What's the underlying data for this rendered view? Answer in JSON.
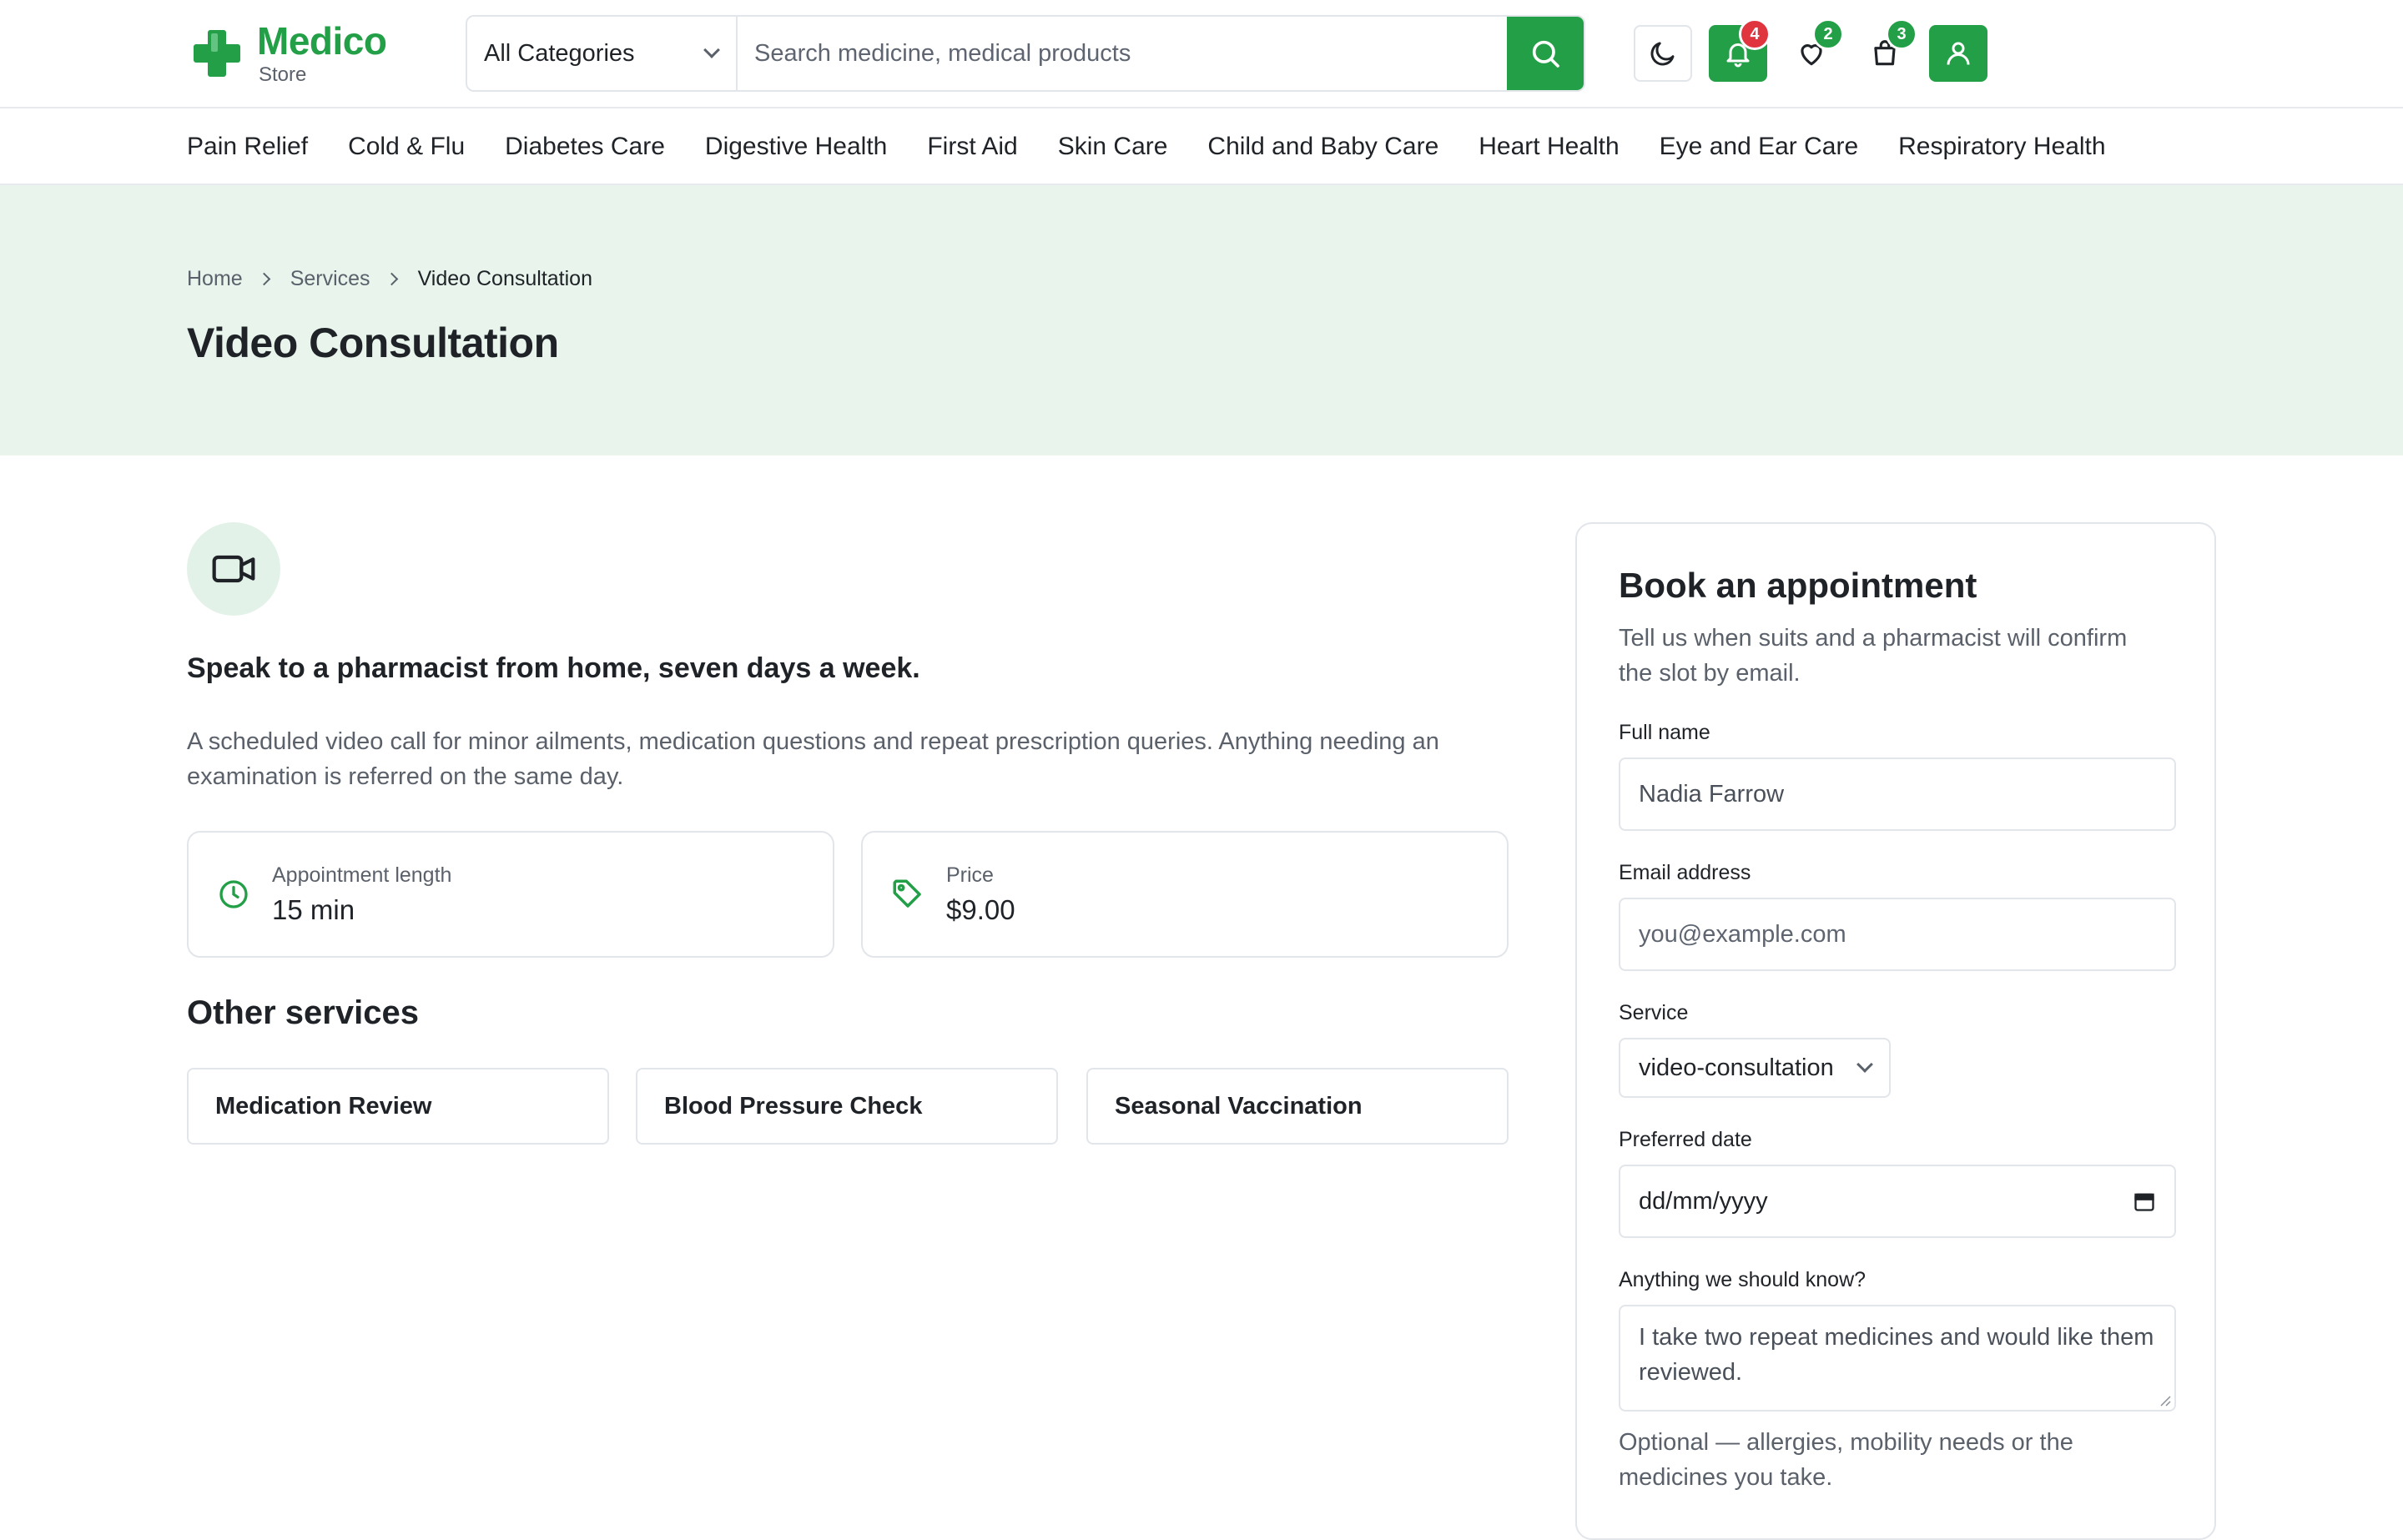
{
  "brand": {
    "name": "Medico",
    "sub": "Store",
    "color": "#23a047"
  },
  "search": {
    "category": "All Categories",
    "placeholder": "Search medicine, medical products"
  },
  "header_icons": {
    "theme": "moon-icon",
    "notifications": {
      "icon": "bell-icon",
      "count": "4"
    },
    "wishlist": {
      "icon": "heart-icon",
      "count": "2"
    },
    "cart": {
      "icon": "shopping-bag-icon",
      "count": "3"
    },
    "account": "user-icon"
  },
  "categories": [
    "Pain Relief",
    "Cold & Flu",
    "Diabetes Care",
    "Digestive Health",
    "First Aid",
    "Skin Care",
    "Child and Baby Care",
    "Heart Health",
    "Eye and Ear Care",
    "Respiratory Health"
  ],
  "breadcrumb": {
    "home": "Home",
    "services": "Services",
    "current": "Video Consultation"
  },
  "page": {
    "title": "Video Consultation"
  },
  "service": {
    "icon": "video-camera-icon",
    "tagline": "Speak to a pharmacist from home, seven days a week.",
    "description": "A scheduled video call for minor ailments, medication questions and repeat prescription queries. Anything needing an examination is referred on the same day.",
    "length_label": "Appointment length",
    "length_value": "15 min",
    "price_label": "Price",
    "price_value": "$9.00"
  },
  "other_services": {
    "title": "Other services",
    "items": [
      "Medication Review",
      "Blood Pressure Check",
      "Seasonal Vaccination"
    ]
  },
  "booking": {
    "title": "Book an appointment",
    "subtitle": "Tell us when suits and a pharmacist will confirm the slot by email.",
    "name_label": "Full name",
    "name_value": "Nadia Farrow",
    "email_label": "Email address",
    "email_placeholder": "you@example.com",
    "service_label": "Service",
    "service_value": "video-consultation",
    "date_label": "Preferred date",
    "date_placeholder": "dd/mm/yyyy",
    "notes_label": "Anything we should know?",
    "notes_value": "I take two repeat medicines and would like them reviewed.",
    "notes_hint": "Optional — allergies, mobility needs or the medicines you take."
  },
  "colors": {
    "accent": "#23a047",
    "hero_bg": "#e8f4ec",
    "badge_alert": "#e0343f"
  }
}
